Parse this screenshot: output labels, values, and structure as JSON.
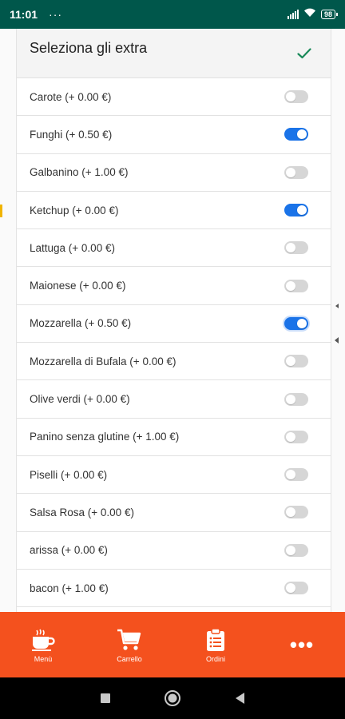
{
  "status_bar": {
    "time": "11:01",
    "dots": "···",
    "battery": "98"
  },
  "dialog": {
    "title": "Seleziona gli extra",
    "confirm_icon": "check-icon",
    "extras": [
      {
        "label": "Carote (+ 0.00 €)",
        "enabled": false
      },
      {
        "label": "Funghi (+ 0.50 €)",
        "enabled": true
      },
      {
        "label": "Galbanino (+ 1.00 €)",
        "enabled": false
      },
      {
        "label": "Ketchup (+ 0.00 €)",
        "enabled": true
      },
      {
        "label": "Lattuga (+ 0.00 €)",
        "enabled": false
      },
      {
        "label": "Maionese (+ 0.00 €)",
        "enabled": false
      },
      {
        "label": "Mozzarella (+ 0.50 €)",
        "enabled": true
      },
      {
        "label": "Mozzarella di Bufala (+ 0.00 €)",
        "enabled": false
      },
      {
        "label": "Olive verdi (+ 0.00 €)",
        "enabled": false
      },
      {
        "label": "Panino senza glutine (+ 1.00 €)",
        "enabled": false
      },
      {
        "label": "Piselli (+ 0.00 €)",
        "enabled": false
      },
      {
        "label": "Salsa Rosa (+ 0.00 €)",
        "enabled": false
      },
      {
        "label": "arissa (+ 0.00 €)",
        "enabled": false
      },
      {
        "label": "bacon (+ 1.00 €)",
        "enabled": false
      }
    ]
  },
  "bottom_nav": {
    "items": [
      {
        "label": "Menù",
        "icon": "coffee-cup-icon"
      },
      {
        "label": "Carrello",
        "icon": "cart-icon"
      },
      {
        "label": "Ordini",
        "icon": "clipboard-icon"
      },
      {
        "label": "",
        "icon": "more-icon"
      }
    ]
  },
  "colors": {
    "status_bar": "#00574b",
    "accent": "#1a73e8",
    "nav_bar": "#f4511e",
    "check": "#1b8a5a"
  }
}
